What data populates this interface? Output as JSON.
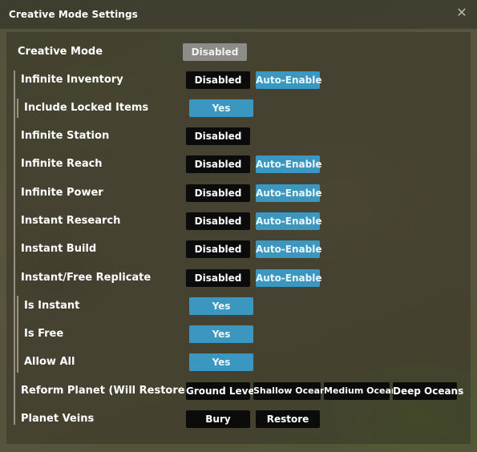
{
  "window": {
    "title": "Creative Mode Settings",
    "close_glyph": "✕"
  },
  "rows": {
    "creative_mode": {
      "label": "Creative Mode",
      "state": "Disabled"
    },
    "infinite_inventory": {
      "label": "Infinite Inventory",
      "state": "Disabled",
      "auto": "Auto-Enable"
    },
    "include_locked": {
      "label": "Include Locked Items",
      "state": "Yes"
    },
    "infinite_station": {
      "label": "Infinite Station",
      "state": "Disabled"
    },
    "infinite_reach": {
      "label": "Infinite Reach",
      "state": "Disabled",
      "auto": "Auto-Enable"
    },
    "infinite_power": {
      "label": "Infinite Power",
      "state": "Disabled",
      "auto": "Auto-Enable"
    },
    "instant_research": {
      "label": "Instant Research",
      "state": "Disabled",
      "auto": "Auto-Enable"
    },
    "instant_build": {
      "label": "Instant Build",
      "state": "Disabled",
      "auto": "Auto-Enable"
    },
    "instant_replicate": {
      "label": "Instant/Free Replicate",
      "state": "Disabled",
      "auto": "Auto-Enable"
    },
    "is_instant": {
      "label": "Is Instant",
      "state": "Yes"
    },
    "is_free": {
      "label": "Is Free",
      "state": "Yes"
    },
    "allow_all": {
      "label": "Allow All",
      "state": "Yes"
    },
    "reform_planet": {
      "label": "Reform Planet (Will Restore Veins)",
      "options": [
        "Ground Level",
        "Shallow Oceans",
        "Medium Oceans",
        "Deep Oceans"
      ]
    },
    "planet_veins": {
      "label": "Planet Veins",
      "options": [
        "Bury",
        "Restore"
      ]
    }
  },
  "colors": {
    "button_dark": "#0b0b0b",
    "button_accent": "#3b97c0",
    "button_disabled": "#8c8c88"
  }
}
